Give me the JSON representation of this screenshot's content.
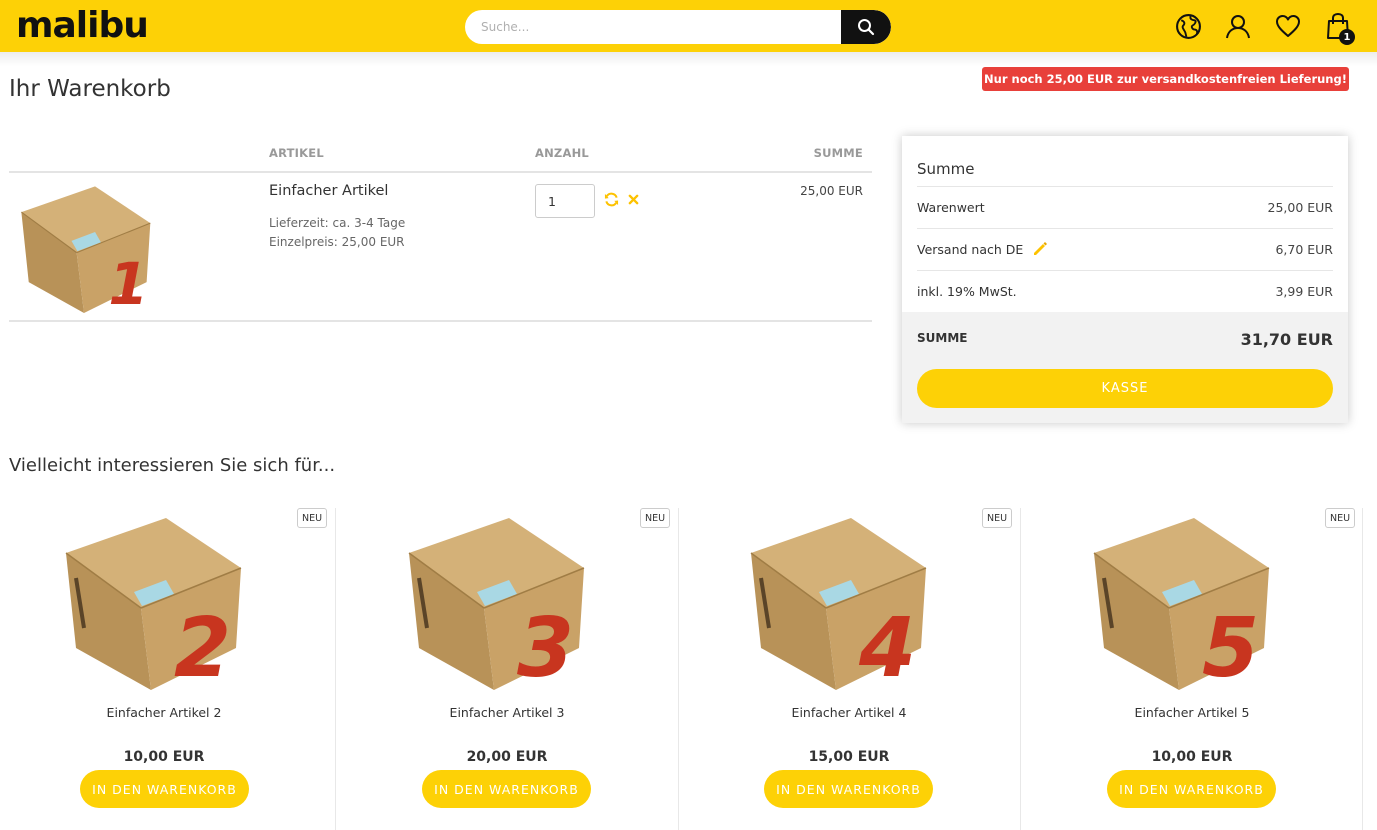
{
  "header": {
    "logo_text": "malibu",
    "search_placeholder": "Suche...",
    "cart_count": "1",
    "brand_color": "#fdd106",
    "icons": [
      "search-icon",
      "globe-icon",
      "account-icon",
      "heart-icon",
      "shopping-bag-icon"
    ]
  },
  "page": {
    "title": "Ihr Warenkorb",
    "shipping_hint": "Nur noch 25,00 EUR zur versandkostenfreien Lieferung!",
    "hint_color": "#e8403a"
  },
  "cart_table": {
    "headers": {
      "article": "ARTIKEL",
      "quantity": "ANZAHL",
      "sum": "SUMME"
    },
    "items": [
      {
        "image_number": "1",
        "name": "Einfacher Artikel",
        "delivery": "Lieferzeit: ca. 3-4 Tage",
        "unit_price": "Einzelpreis: 25,00 EUR",
        "quantity": "1",
        "sum": "25,00 EUR"
      }
    ]
  },
  "summary": {
    "title": "Summe",
    "rows": [
      {
        "label": "Warenwert",
        "value": "25,00 EUR"
      },
      {
        "label": "Versand nach DE",
        "value": "6,70 EUR"
      },
      {
        "label": "inkl. 19% MwSt.",
        "value": "3,99 EUR"
      }
    ],
    "total_label": "SUMME",
    "total_value": "31,70 EUR",
    "checkout_label": "KASSE"
  },
  "recommendations": {
    "title": "Vielleicht interessieren Sie sich für...",
    "badge": "NEU",
    "button_label": "IN DEN WARENKORB",
    "products": [
      {
        "image_number": "2",
        "name": "Einfacher Artikel 2",
        "price": "10,00 EUR"
      },
      {
        "image_number": "3",
        "name": "Einfacher Artikel 3",
        "price": "20,00 EUR"
      },
      {
        "image_number": "4",
        "name": "Einfacher Artikel 4",
        "price": "15,00 EUR"
      },
      {
        "image_number": "5",
        "name": "Einfacher Artikel 5",
        "price": "10,00 EUR"
      }
    ]
  }
}
